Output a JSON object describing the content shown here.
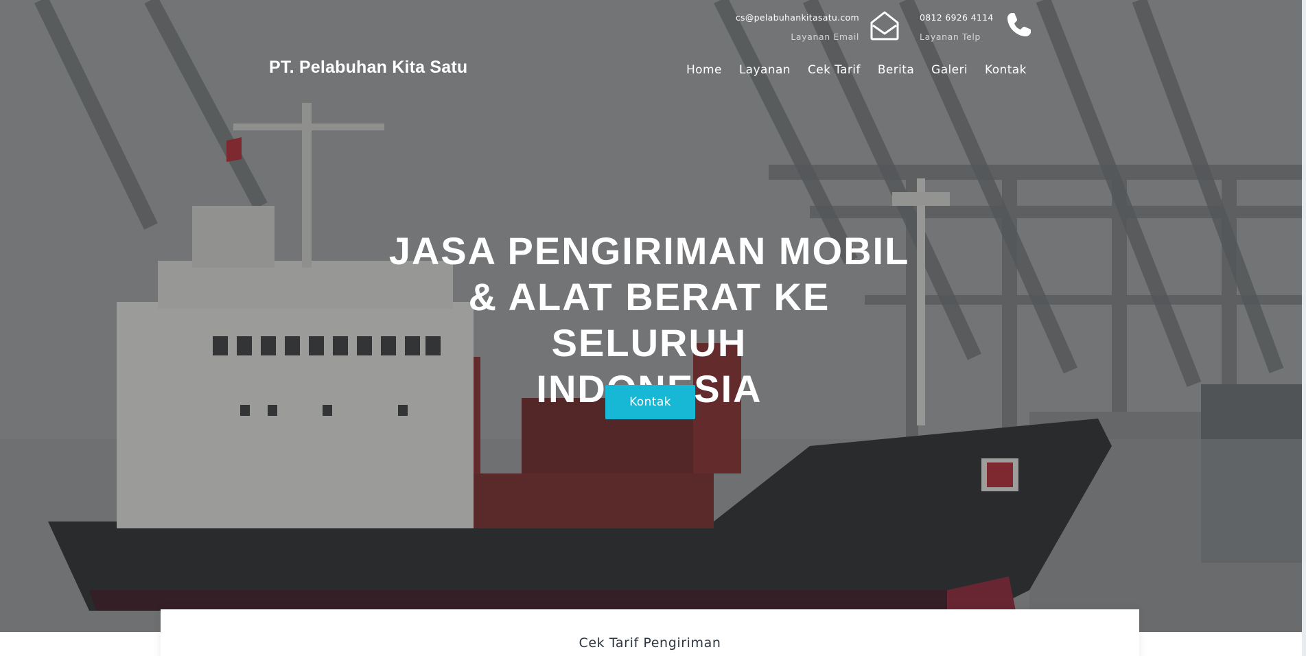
{
  "header": {
    "brand": "PT. Pelabuhan Kita Satu",
    "email": {
      "value": "cs@pelabuhankitasatu.com",
      "label": "Layanan Email",
      "icon": "envelope-icon"
    },
    "phone": {
      "value": "0812 6926 4114",
      "label": "Layanan Telp",
      "icon": "phone-icon"
    }
  },
  "nav": {
    "items": [
      {
        "label": "Home"
      },
      {
        "label": "Layanan"
      },
      {
        "label": "Cek Tarif"
      },
      {
        "label": "Berita"
      },
      {
        "label": "Galeri"
      },
      {
        "label": "Kontak"
      }
    ]
  },
  "hero": {
    "headline_line1": "JASA PENGIRIMAN MOBIL",
    "headline_line2": "& ALAT BERAT KE SELURUH",
    "headline_line3": "INDONESIA",
    "cta_label": "Kontak"
  },
  "rate_card": {
    "title": "Cek Tarif Pengiriman"
  },
  "colors": {
    "accent": "#17b8d6",
    "text_dark": "#2e3640",
    "overlay": "rgba(40,40,40,0.38)"
  }
}
